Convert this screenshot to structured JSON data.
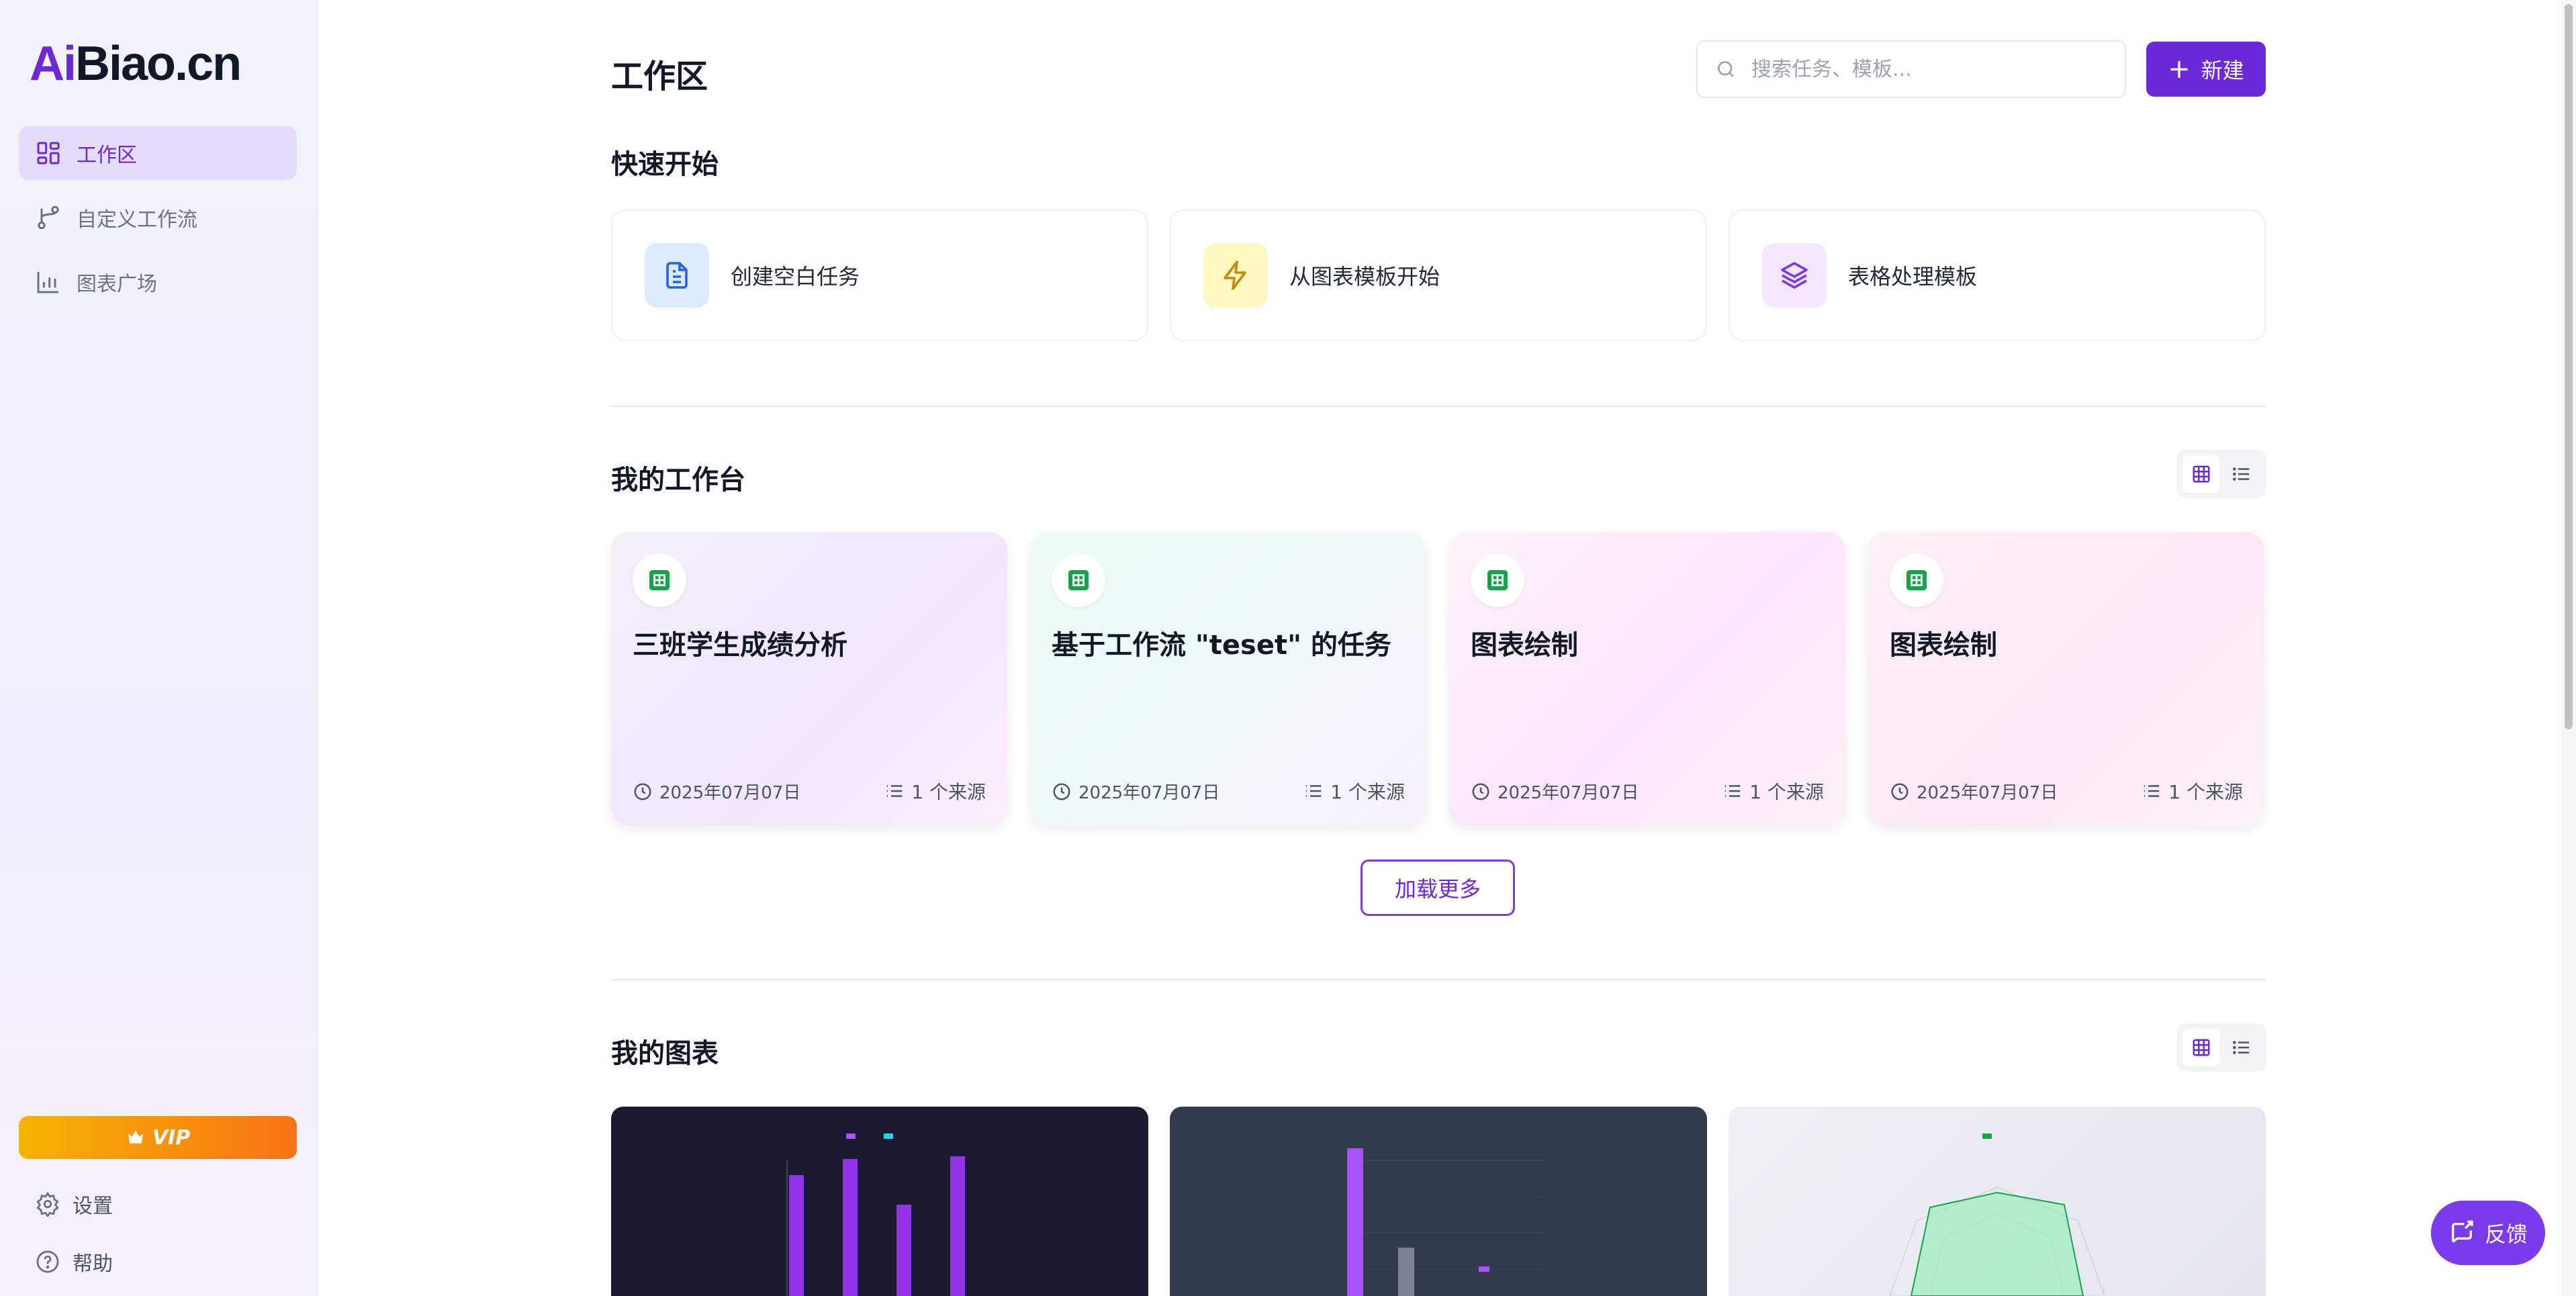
{
  "sidebar": {
    "logo_ai": "Ai",
    "logo_rest": "Biao.cn",
    "items": [
      {
        "label": "工作区",
        "icon": "dashboard-icon",
        "active": true
      },
      {
        "label": "自定义工作流",
        "icon": "workflow-icon",
        "active": false
      },
      {
        "label": "图表广场",
        "icon": "bar-chart-icon",
        "active": false
      }
    ],
    "vip_label": "VIP",
    "settings_label": "设置",
    "help_label": "帮助"
  },
  "header": {
    "title": "工作区",
    "search_placeholder": "搜索任务、模板...",
    "new_label": "新建"
  },
  "quick_start": {
    "title": "快速开始",
    "cards": [
      {
        "label": "创建空白任务",
        "icon": "document-icon",
        "color": "#2563eb",
        "bg": "#dbeafe"
      },
      {
        "label": "从图表模板开始",
        "icon": "lightning-icon",
        "color": "#ca8a04",
        "bg": "#fef9c3"
      },
      {
        "label": "表格处理模板",
        "icon": "layers-icon",
        "color": "#7c3aed",
        "bg": "#f3e8ff"
      }
    ]
  },
  "workbench": {
    "title": "我的工作台",
    "load_more": "加载更多",
    "cards": [
      {
        "name": "三班学生成绩分析",
        "date": "2025年07月07日",
        "sources": "1 个来源"
      },
      {
        "name": "基于工作流 \"teset\" 的任务",
        "date": "2025年07月07日",
        "sources": "1 个来源"
      },
      {
        "name": "图表绘制",
        "date": "2025年07月07日",
        "sources": "1 个来源"
      },
      {
        "name": "图表绘制",
        "date": "2025年07月07日",
        "sources": "1 个来源"
      }
    ]
  },
  "charts": {
    "title": "我的图表"
  },
  "feedback_label": "反馈",
  "colors": {
    "accent": "#6d28d9",
    "sheet_green": "#16a34a"
  }
}
